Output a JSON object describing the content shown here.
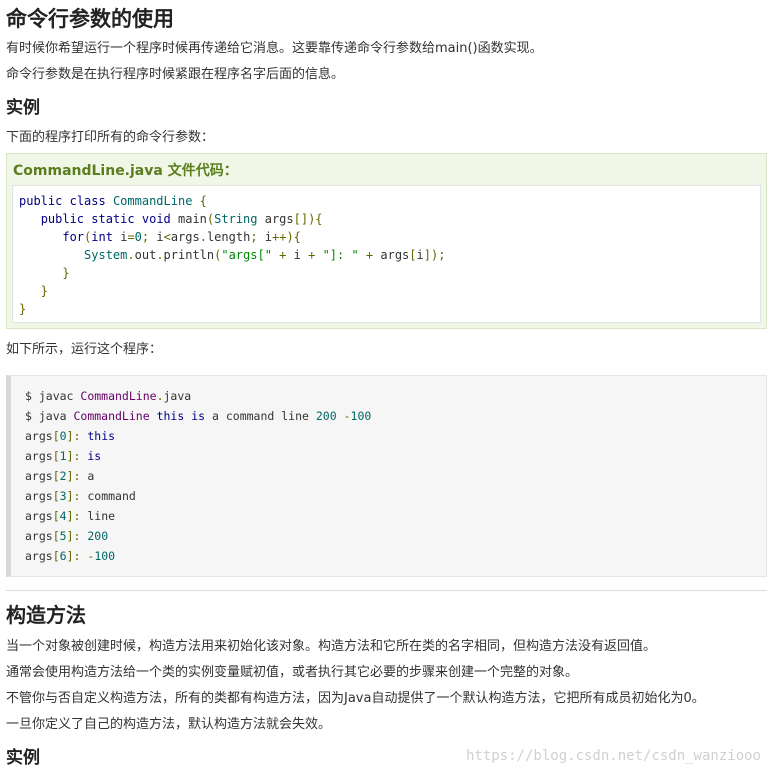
{
  "section1": {
    "title": "命令行参数的使用",
    "para1": "有时候你希望运行一个程序时候再传递给它消息。这要靠传递命令行参数给main()函数实现。",
    "para2": "命令行参数是在执行程序时候紧跟在程序名字后面的信息。",
    "example_heading": "实例",
    "example_intro": "下面的程序打印所有的命令行参数：",
    "code_title": "CommandLine.java 文件代码：",
    "code_lines": [
      "public class CommandLine {",
      "   public static void main(String args[]){",
      "      for(int i=0; i<args.length; i++){",
      "         System.out.println(\"args[\" + i + \"]: \" + args[i]);",
      "      }",
      "   }",
      "}"
    ],
    "run_intro": "如下所示，运行这个程序：",
    "shell_lines": [
      "$ javac CommandLine.java",
      "$ java CommandLine this is a command line 200 -100",
      "args[0]: this",
      "args[1]: is",
      "args[2]: a",
      "args[3]: command",
      "args[4]: line",
      "args[5]: 200",
      "args[6]: -100"
    ]
  },
  "section2": {
    "title": "构造方法",
    "para1": "当一个对象被创建时候，构造方法用来初始化该对象。构造方法和它所在类的名字相同，但构造方法没有返回值。",
    "para2": "通常会使用构造方法给一个类的实例变量赋初值，或者执行其它必要的步骤来创建一个完整的对象。",
    "para3": "不管你与否自定义构造方法，所有的类都有构造方法，因为Java自动提供了一个默认构造方法，它把所有成员初始化为0。",
    "para4": "一旦你定义了自己的构造方法，默认构造方法就会失效。",
    "example_heading": "实例"
  },
  "watermark": "https://blog.csdn.net/csdn_wanziooo"
}
